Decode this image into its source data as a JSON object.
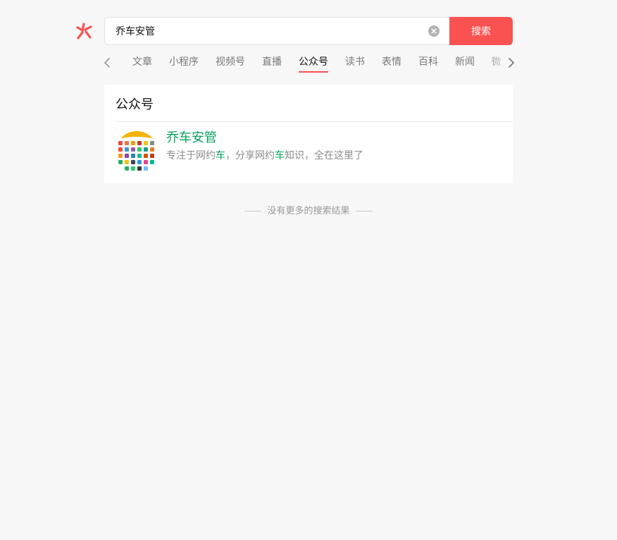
{
  "search": {
    "query": "乔车安管",
    "button_label": "搜索"
  },
  "tabs": [
    {
      "label": "文章"
    },
    {
      "label": "小程序"
    },
    {
      "label": "视频号"
    },
    {
      "label": "直播"
    },
    {
      "label": "公众号",
      "active": true
    },
    {
      "label": "读书"
    },
    {
      "label": "表情"
    },
    {
      "label": "百科"
    },
    {
      "label": "新闻"
    },
    {
      "label": "微"
    }
  ],
  "section": {
    "title": "公众号"
  },
  "result": {
    "name": "乔车安管",
    "desc_parts": [
      "专注于网约",
      "车",
      "，分享网约",
      "车",
      "知识，全在这里了"
    ]
  },
  "footer": {
    "end_text": "没有更多的搜索结果"
  },
  "colors": {
    "accent": "#fa5151",
    "highlight": "#07a05c",
    "background": "#f7f7f7"
  }
}
